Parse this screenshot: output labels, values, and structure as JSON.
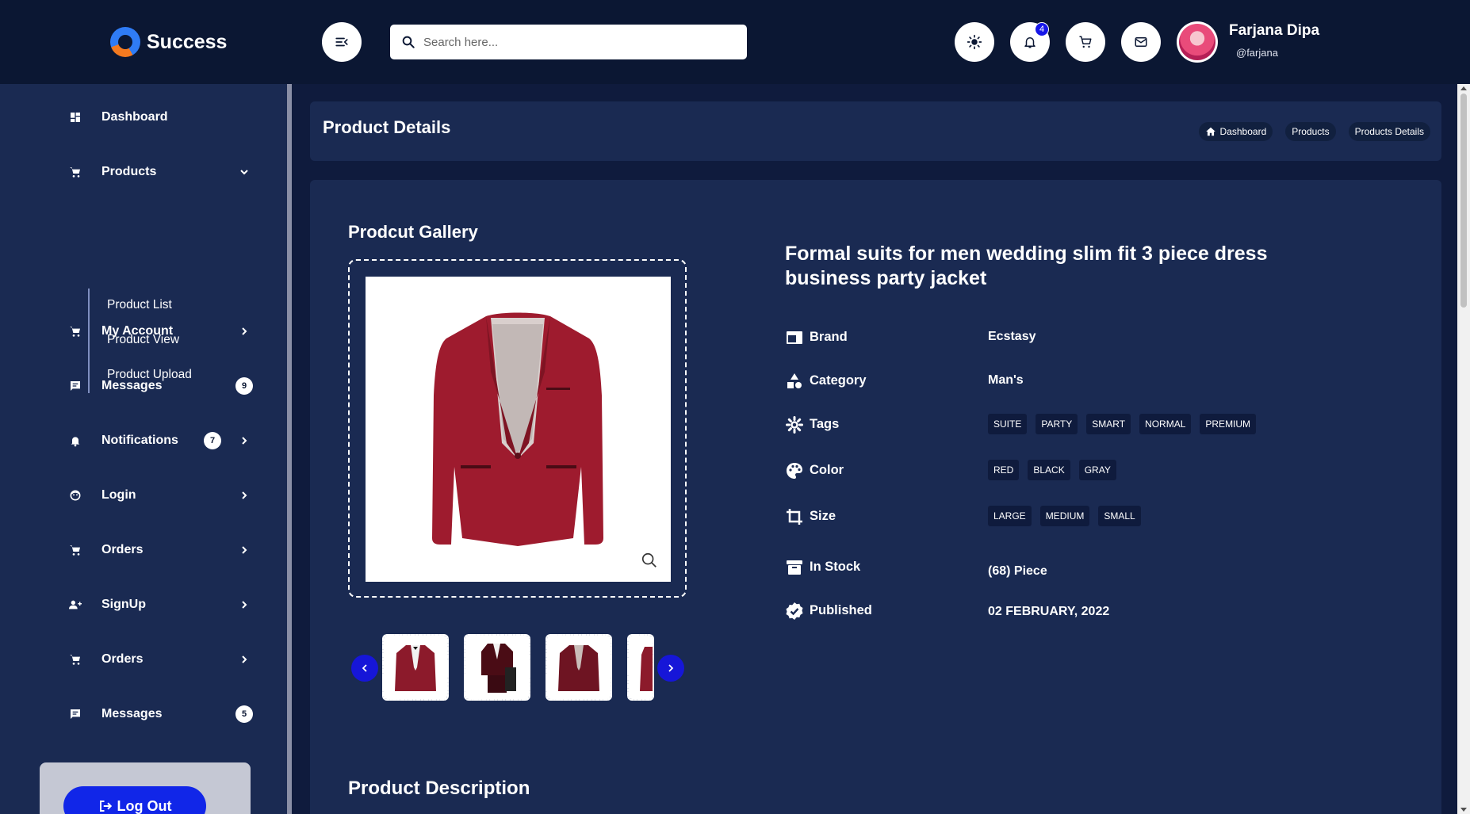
{
  "app": {
    "name": "Success"
  },
  "header": {
    "search_placeholder": "Search here...",
    "notification_count": "4",
    "user": {
      "name": "Farjana Dipa",
      "handle": "@farjana"
    }
  },
  "sidebar": {
    "items": [
      {
        "label": "Dashboard",
        "icon": "dashboard-icon"
      },
      {
        "label": "Products",
        "icon": "cart-icon"
      },
      {
        "label": "My Account",
        "icon": "cart-icon"
      },
      {
        "label": "Messages",
        "icon": "message-icon",
        "badge": "9"
      },
      {
        "label": "Notifications",
        "icon": "bell-icon",
        "badge": "7"
      },
      {
        "label": "Login",
        "icon": "face-icon"
      },
      {
        "label": "Orders",
        "icon": "cart-icon"
      },
      {
        "label": "SignUp",
        "icon": "user-add-icon"
      },
      {
        "label": "Orders",
        "icon": "cart-icon"
      },
      {
        "label": "Messages",
        "icon": "message-icon",
        "badge": "5"
      }
    ],
    "submenu": [
      "Product List",
      "Product View",
      "Product Upload"
    ],
    "logout_label": "Log Out"
  },
  "page": {
    "title": "Product Details",
    "breadcrumbs": [
      "Dashboard",
      "Products",
      "Products Details"
    ]
  },
  "gallery": {
    "title": "Prodcut Gallery"
  },
  "product": {
    "title": "Formal suits for men wedding slim fit 3 piece dress business party jacket",
    "brand_label": "Brand",
    "brand": "Ecstasy",
    "category_label": "Category",
    "category": "Man's",
    "tags_label": "Tags",
    "tags": [
      "SUITE",
      "PARTY",
      "SMART",
      "NORMAL",
      "PREMIUM"
    ],
    "color_label": "Color",
    "colors": [
      "RED",
      "BLACK",
      "GRAY"
    ],
    "size_label": "Size",
    "sizes": [
      "LARGE",
      "MEDIUM",
      "SMALL"
    ],
    "stock_label": "In Stock",
    "stock": "(68) Piece",
    "published_label": "Published",
    "published": "02 FEBRUARY, 2022"
  },
  "description": {
    "title": "Product Description"
  },
  "colors": {
    "header_bg": "#0b1733",
    "panel_bg": "#1a2a52",
    "accent": "#1616d8",
    "jacket": "#9e1b2e"
  }
}
